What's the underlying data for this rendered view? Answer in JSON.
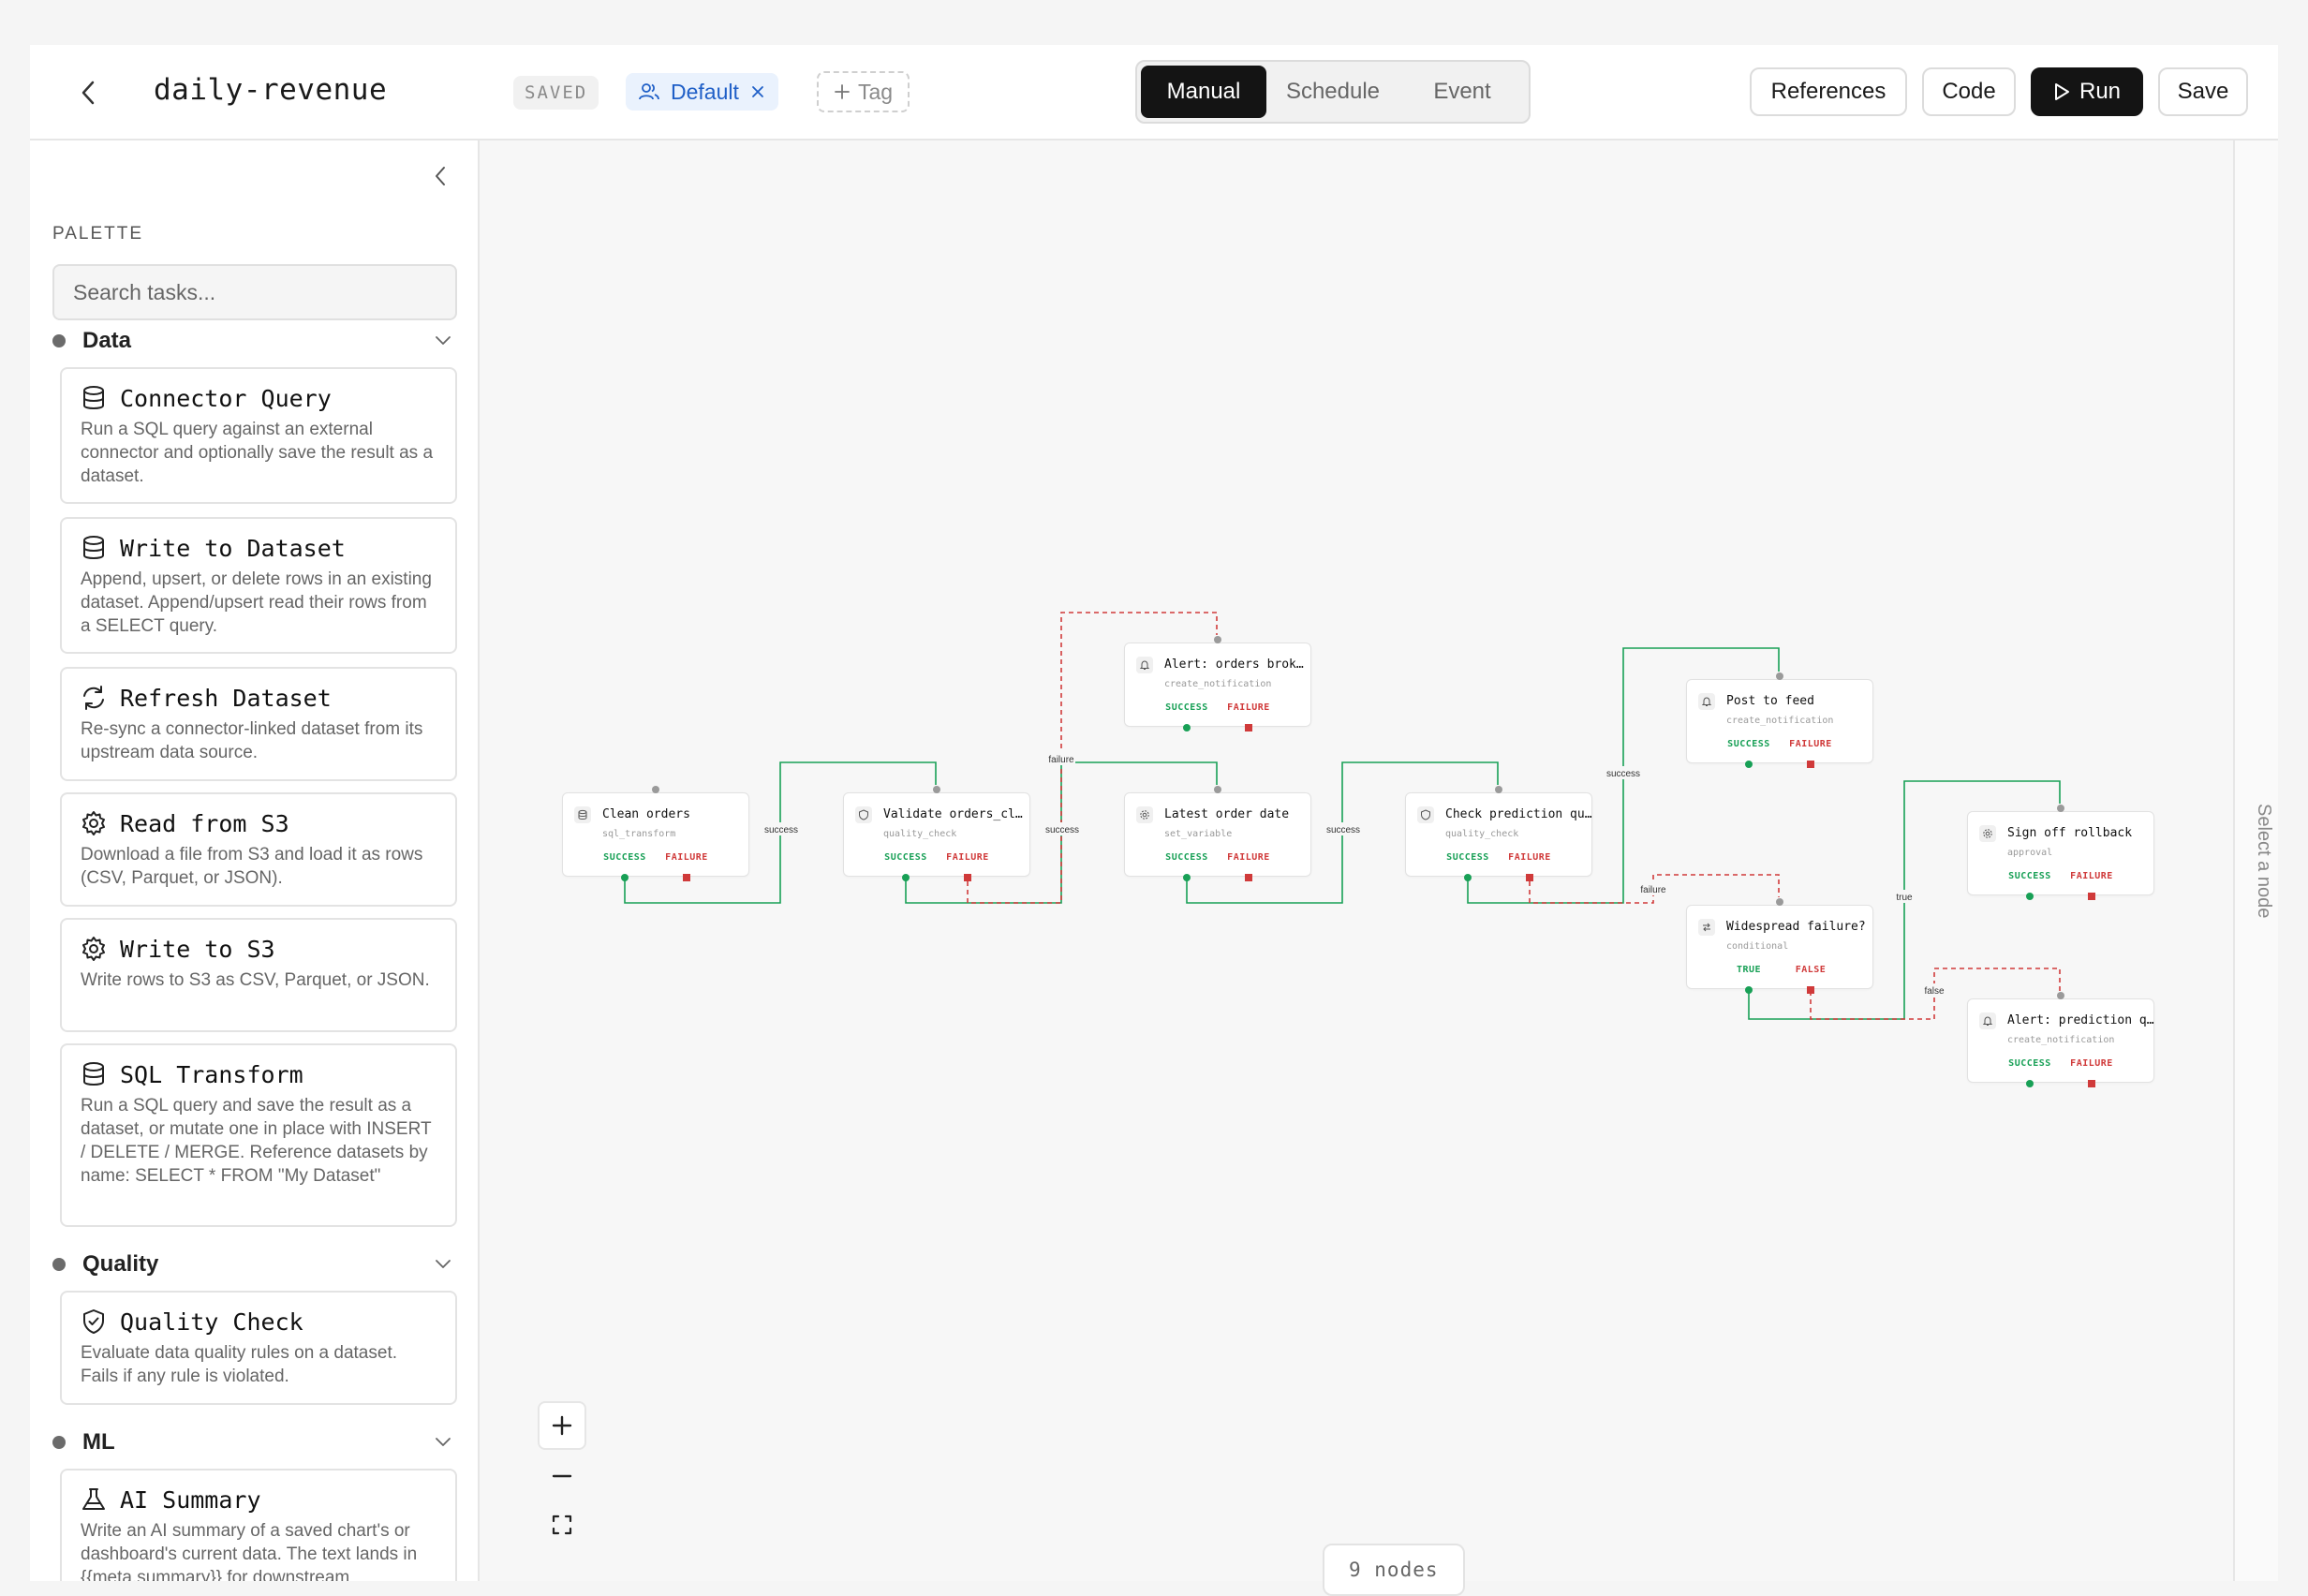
{
  "header": {
    "pipeline_name": "daily-revenue",
    "status": "SAVED",
    "chip_default": "Default",
    "chip_tag": "Tag",
    "trigger_tabs": [
      {
        "label": "Manual",
        "active": true
      },
      {
        "label": "Schedule",
        "active": false
      },
      {
        "label": "Event",
        "active": false
      }
    ],
    "buttons": {
      "references": "References",
      "code": "Code",
      "run": "Run",
      "save": "Save"
    }
  },
  "sidebar": {
    "title": "PALETTE",
    "search_placeholder": "Search tasks...",
    "categories": [
      {
        "name": "Data"
      },
      {
        "name": "Quality"
      },
      {
        "name": "ML"
      }
    ],
    "cards": [
      {
        "title": "Connector Query",
        "icon": "database-icon",
        "desc": "Run a SQL query against an external connector and optionally save the result as a dataset."
      },
      {
        "title": "Write to Dataset",
        "icon": "database-icon",
        "desc": "Append, upsert, or delete rows in an existing dataset. Append/upsert read their rows from a SELECT query."
      },
      {
        "title": "Refresh Dataset",
        "icon": "refresh-icon",
        "desc": "Re-sync a connector-linked dataset from its upstream data source."
      },
      {
        "title": "Read from S3",
        "icon": "gear-icon",
        "desc": "Download a file from S3 and load it as rows (CSV, Parquet, or JSON)."
      },
      {
        "title": "Write to S3",
        "icon": "gear-icon",
        "desc": "Write rows to S3 as CSV, Parquet, or JSON."
      },
      {
        "title": "SQL Transform",
        "icon": "database-icon",
        "desc": "Run a SQL query and save the result as a dataset, or mutate one in place with INSERT / DELETE / MERGE. Reference datasets by name: SELECT * FROM \"My Dataset\""
      },
      {
        "title": "Quality Check",
        "icon": "shield-check-icon",
        "desc": "Evaluate data quality rules on a dataset. Fails if any rule is violated."
      },
      {
        "title": "AI Summary",
        "icon": "flask-icon",
        "desc": "Write an AI summary of a saved chart's or dashboard's current data. The text lands in {{meta.summary}} for downstream"
      }
    ]
  },
  "canvas": {
    "nodes": [
      {
        "id": "clean",
        "title": "Clean orders",
        "type": "sql_transform",
        "icon": "database-icon",
        "ok": "SUCCESS",
        "bad": "FAILURE"
      },
      {
        "id": "validate",
        "title": "Validate orders_cl…",
        "type": "quality_check",
        "icon": "shield-icon",
        "ok": "SUCCESS",
        "bad": "FAILURE"
      },
      {
        "id": "alert_broken",
        "title": "Alert: orders brok…",
        "type": "create_notification",
        "icon": "bell-icon",
        "ok": "SUCCESS",
        "bad": "FAILURE"
      },
      {
        "id": "latest",
        "title": "Latest order date",
        "type": "set_variable",
        "icon": "gear-icon",
        "ok": "SUCCESS",
        "bad": "FAILURE"
      },
      {
        "id": "check_pred",
        "title": "Check prediction qu…",
        "type": "quality_check",
        "icon": "shield-icon",
        "ok": "SUCCESS",
        "bad": "FAILURE"
      },
      {
        "id": "post_feed",
        "title": "Post to feed",
        "type": "create_notification",
        "icon": "bell-icon",
        "ok": "SUCCESS",
        "bad": "FAILURE"
      },
      {
        "id": "widespread",
        "title": "Widespread failure?",
        "type": "conditional",
        "icon": "branch-icon",
        "ok": "TRUE",
        "bad": "FALSE"
      },
      {
        "id": "signoff",
        "title": "Sign off rollback",
        "type": "approval",
        "icon": "gear-icon",
        "ok": "SUCCESS",
        "bad": "FAILURE"
      },
      {
        "id": "alert_pred",
        "title": "Alert: prediction q…",
        "type": "create_notification",
        "icon": "bell-icon",
        "ok": "SUCCESS",
        "bad": "FAILURE"
      }
    ],
    "edge_labels": {
      "success": "success",
      "failure": "failure",
      "true": "true",
      "false": "false"
    },
    "node_count": "9 nodes",
    "colors": {
      "success": "#18a056",
      "failure": "#d03a3a"
    }
  },
  "right_panel": {
    "placeholder": "Select a node"
  }
}
